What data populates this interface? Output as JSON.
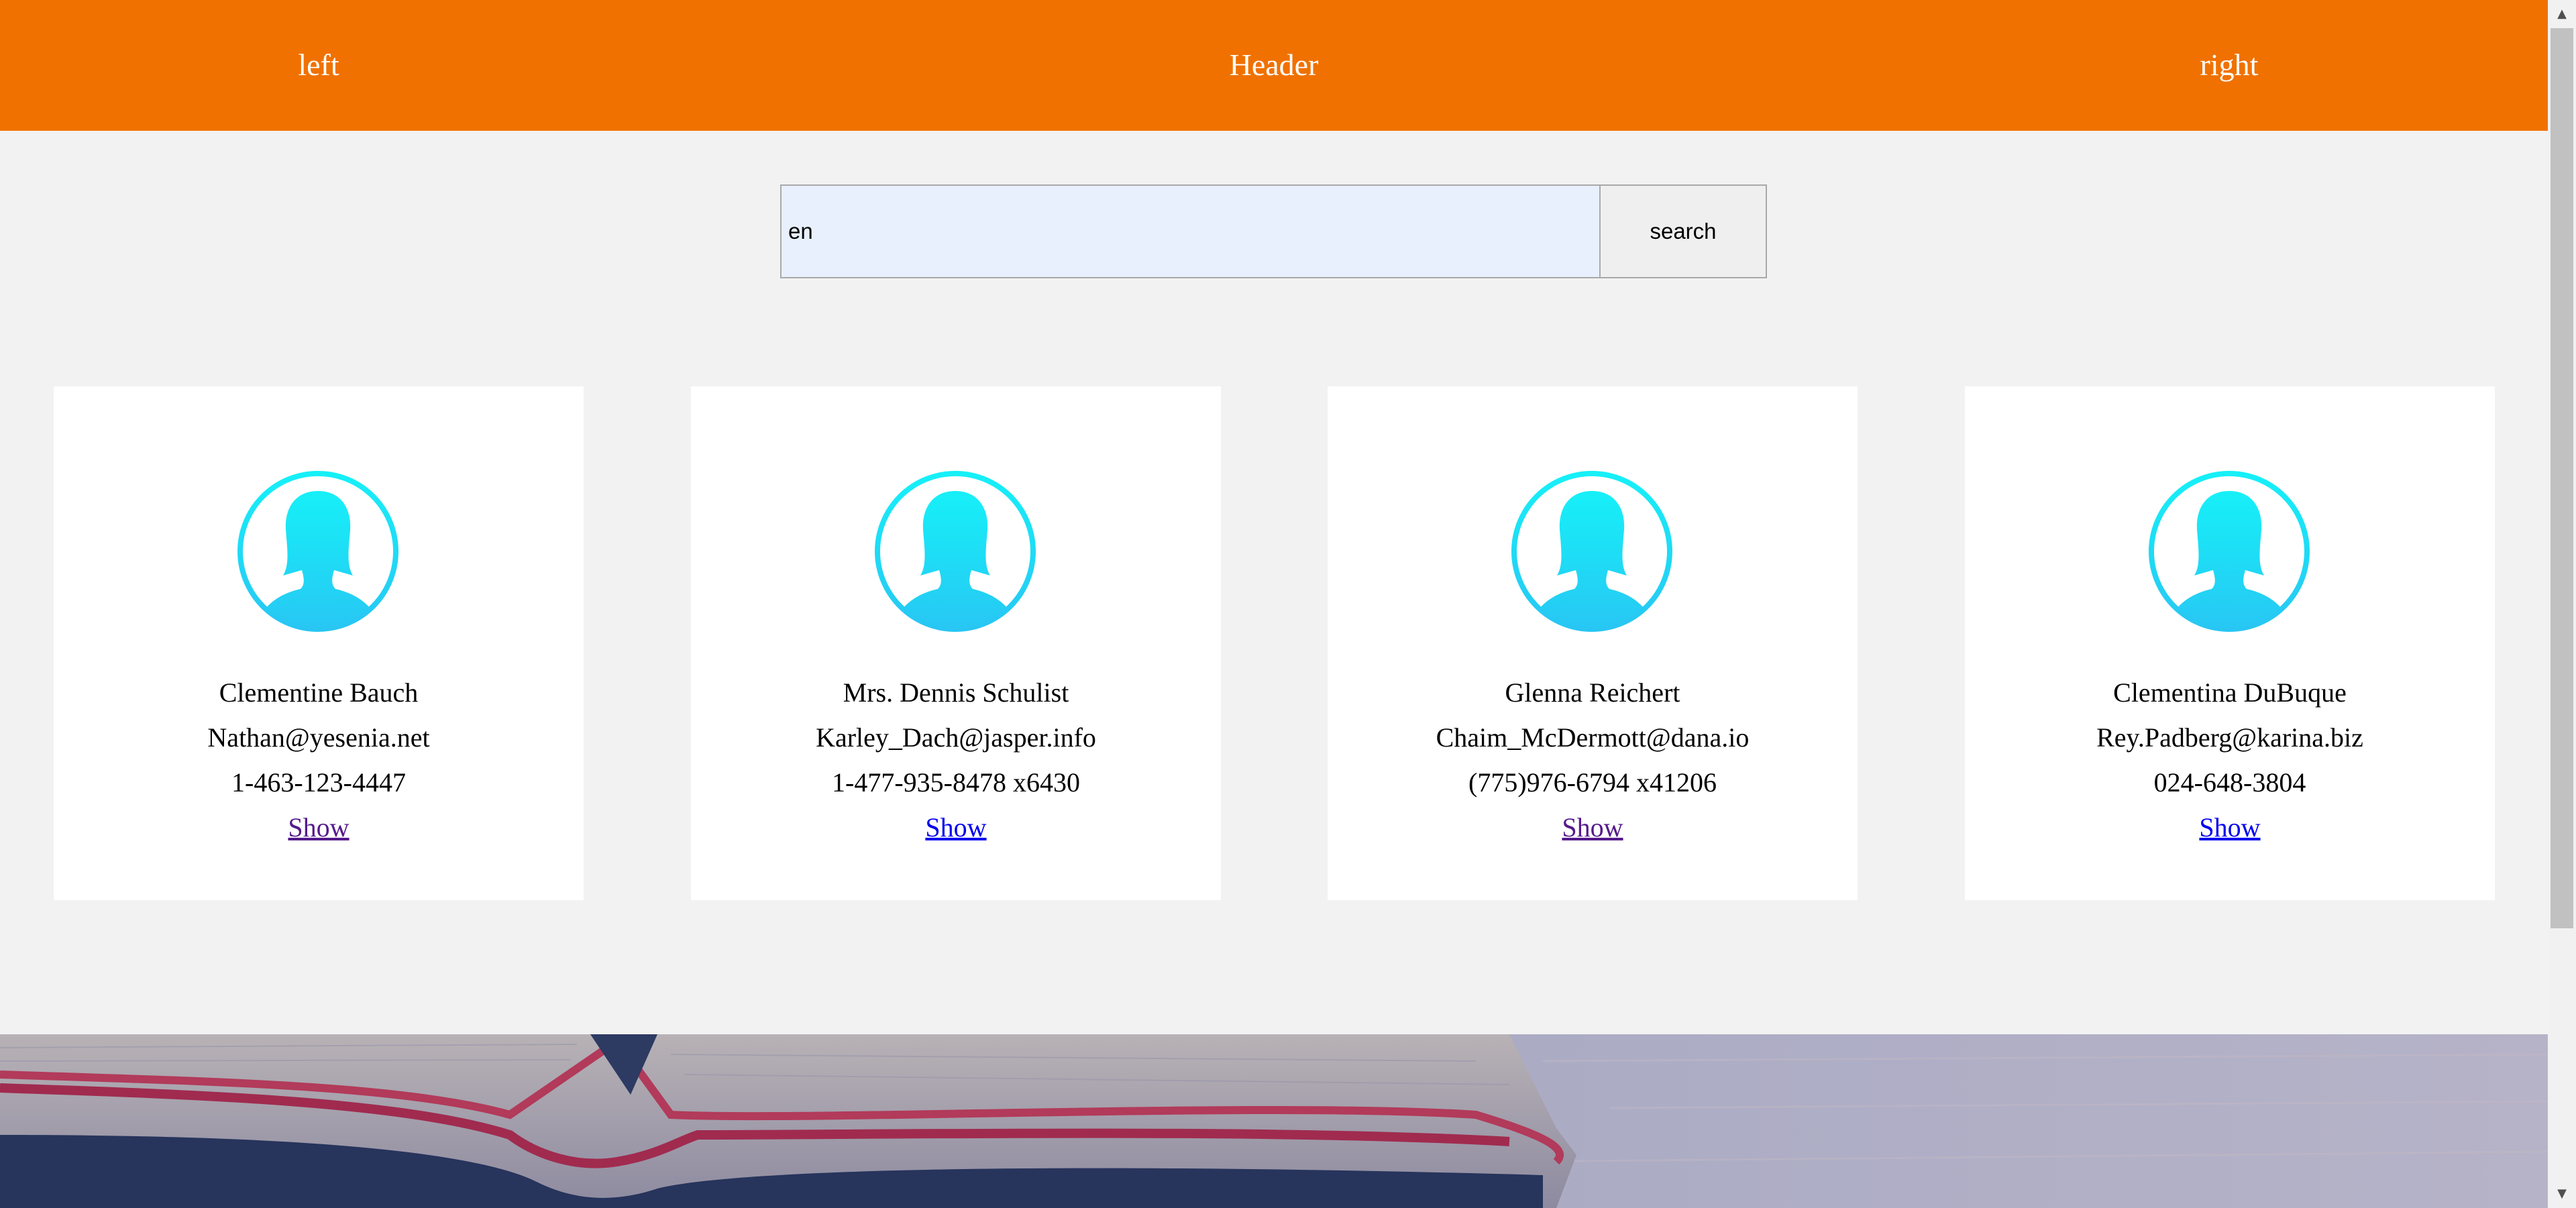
{
  "header": {
    "left": "left",
    "center": "Header",
    "right": "right"
  },
  "search": {
    "value": "en",
    "button_label": "search"
  },
  "users": [
    {
      "name": "Clementine Bauch",
      "email": "Nathan@yesenia.net",
      "phone": "1-463-123-4447",
      "link_label": "Show"
    },
    {
      "name": "Mrs. Dennis Schulist",
      "email": "Karley_Dach@jasper.info",
      "phone": "1-477-935-8478 x6430",
      "link_label": "Show"
    },
    {
      "name": "Glenna Reichert",
      "email": "Chaim_McDermott@dana.io",
      "phone": "(775)976-6794 x41206",
      "link_label": "Show"
    },
    {
      "name": "Clementina DuBuque",
      "email": "Rey.Padberg@karina.biz",
      "phone": "024-648-3804",
      "link_label": "Show"
    }
  ],
  "colors": {
    "header_bg": "#f07100",
    "avatar": "#1fd0f5",
    "visited_link": "#551a8b",
    "link": "#0000ee"
  },
  "icons": {
    "avatar": "user-avatar-icon",
    "scroll_up": "scroll-up-arrow-icon",
    "scroll_down": "scroll-down-arrow-icon"
  }
}
